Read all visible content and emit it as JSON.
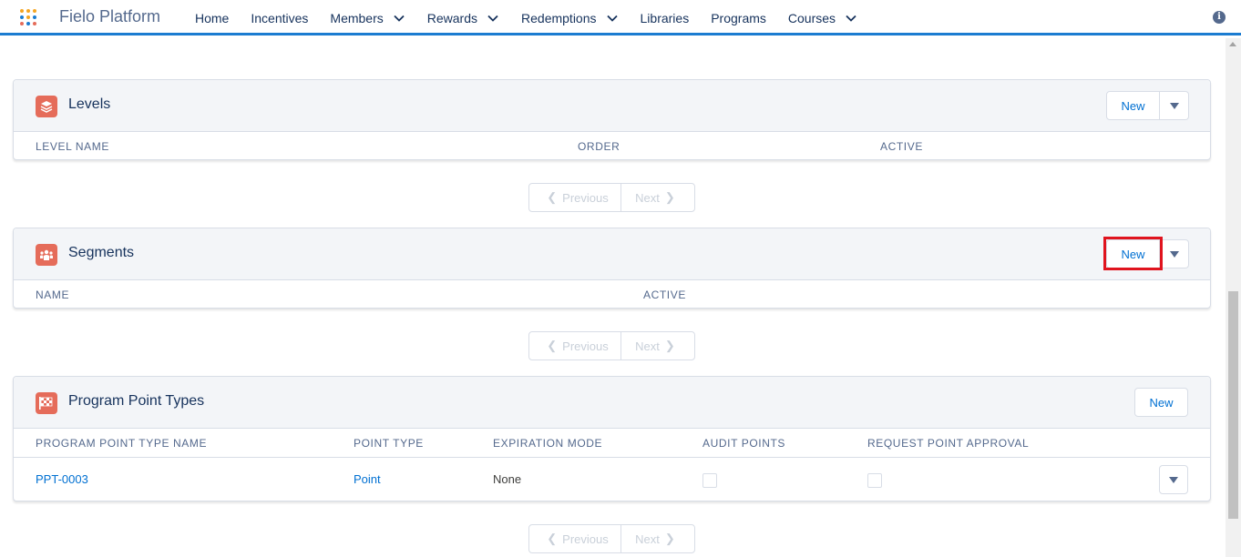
{
  "app": {
    "name": "Fielo Platform",
    "waffle_colors": [
      "#f5a623",
      "#1b7cd1",
      "#e56c5a",
      "#f5a623",
      "#1b7cd1",
      "#e56c5a",
      "#f5a623",
      "#1b7cd1",
      "#e56c5a"
    ]
  },
  "nav": {
    "items": [
      {
        "label": "Home",
        "dropdown": false
      },
      {
        "label": "Incentives",
        "dropdown": false
      },
      {
        "label": "Members",
        "dropdown": true
      },
      {
        "label": "Rewards",
        "dropdown": true
      },
      {
        "label": "Redemptions",
        "dropdown": true
      },
      {
        "label": "Libraries",
        "dropdown": false
      },
      {
        "label": "Programs",
        "dropdown": false
      },
      {
        "label": "Courses",
        "dropdown": true
      }
    ],
    "info_icon": "i"
  },
  "levels": {
    "title": "Levels",
    "icon": "layers-icon",
    "new_label": "New",
    "columns": [
      "LEVEL NAME",
      "ORDER",
      "ACTIVE"
    ]
  },
  "segments": {
    "title": "Segments",
    "icon": "people-icon",
    "new_label": "New",
    "highlight_color": "#e0141e",
    "columns": [
      "NAME",
      "ACTIVE"
    ]
  },
  "point_types": {
    "title": "Program Point Types",
    "icon": "flag-icon",
    "new_label": "New",
    "columns": [
      "PROGRAM POINT TYPE NAME",
      "POINT TYPE",
      "EXPIRATION MODE",
      "AUDIT POINTS",
      "REQUEST POINT APPROVAL"
    ],
    "rows": [
      {
        "name": "PPT-0003",
        "point_type": "Point",
        "expiration_mode": "None",
        "audit_points": false,
        "request_point_approval": false
      }
    ]
  },
  "pager": {
    "previous": "Previous",
    "next": "Next"
  },
  "colors": {
    "accent": "#1b7cd1",
    "link": "#0070d2",
    "icon_bg": "#e56c5a"
  }
}
